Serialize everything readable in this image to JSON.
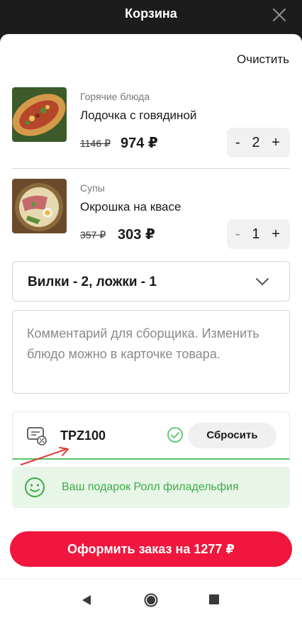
{
  "header": {
    "title": "Корзина",
    "close_icon": "close-icon"
  },
  "actions": {
    "clear_label": "Очистить"
  },
  "cart": {
    "items": [
      {
        "category": "Горячие блюда",
        "name": "Лодочка с говядиной",
        "old_price": "1146 ₽",
        "price": "974 ₽",
        "quantity": "2",
        "minus": "-",
        "plus": "+"
      },
      {
        "category": "Супы",
        "name": "Окрошка на квасе",
        "old_price": "357 ₽",
        "price": "303 ₽",
        "quantity": "1",
        "minus": "-",
        "plus": "+"
      }
    ]
  },
  "cutlery": {
    "selected": "Вилки - 2, ложки - 1",
    "icon": "chevron-down-icon"
  },
  "comment": {
    "placeholder": "Комментарий для сборщика. Изменить блюдо можно в карточке товара."
  },
  "promo": {
    "code": "TPZ100",
    "reset_label": "Сбросить",
    "status_color": "#58c46a"
  },
  "gift": {
    "text": "Ваш подарок Ролл филадельфия",
    "color": "#3faa49"
  },
  "checkout": {
    "label": "Оформить заказ на 1277 ₽",
    "color": "#f0163d"
  }
}
